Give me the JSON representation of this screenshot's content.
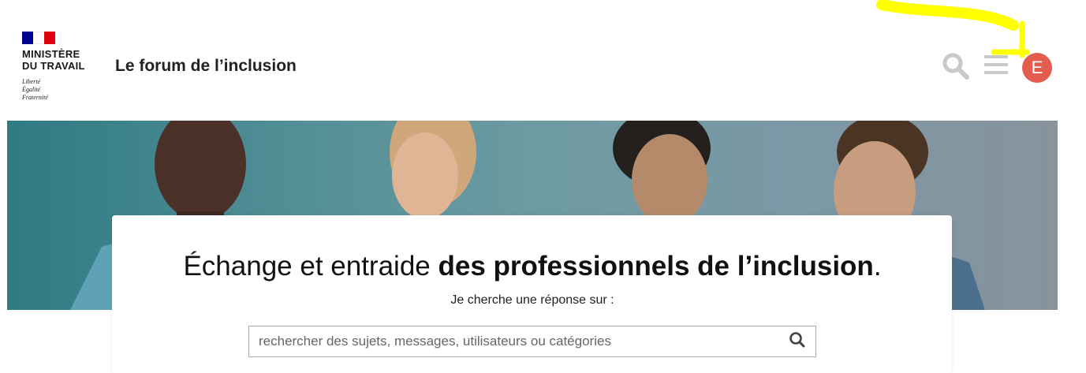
{
  "header": {
    "ministry_line1": "MINISTÈRE",
    "ministry_line2": "DU TRAVAIL",
    "motto": [
      "Liberté",
      "Égalité",
      "Fraternité"
    ],
    "site_title": "Le forum de l’inclusion",
    "search_icon": "search-icon",
    "menu_icon": "hamburger-menu-icon",
    "avatar_letter": "E",
    "avatar_color": "#e45c4d",
    "icon_color": "#c9c9c9"
  },
  "hero": {
    "headline_regular": "Échange et entraide ",
    "headline_bold": "des professionnels de l’inclusion",
    "headline_end": ".",
    "subtitle": "Je cherche une réponse sur :",
    "search_placeholder": "rechercher des sujets, messages, utilisateurs ou catégories"
  },
  "colors": {
    "annotation_arrow": "#ffff00",
    "flag_blue": "#000091",
    "flag_red": "#e1000f"
  }
}
